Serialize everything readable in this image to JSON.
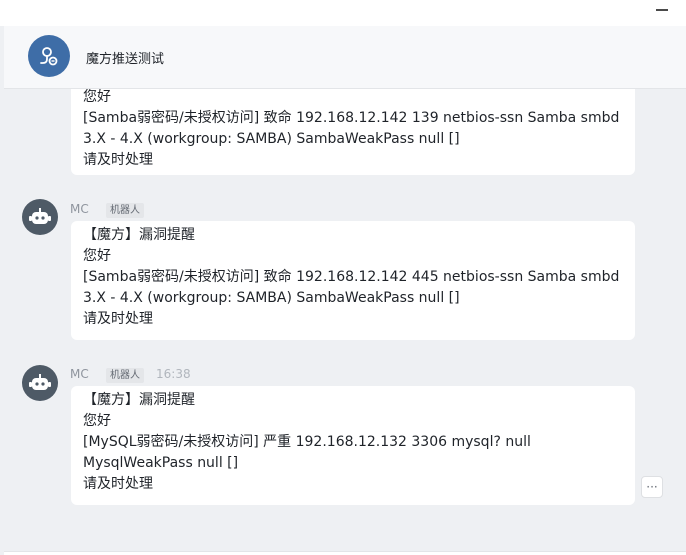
{
  "window": {
    "minimize_icon": "minimize-icon"
  },
  "header": {
    "group_name": "魔方推送测试",
    "avatar_icon": "group-link-icon",
    "avatar_color": "#3e6da7"
  },
  "messages": [
    {
      "lines": [
        "您好",
        "[Samba弱密码/未授权访问]  致命   192.168.12.142  139  netbios-ssn  Samba smbd",
        "3.X - 4.X (workgroup: SAMBA)  SambaWeakPass  null  []",
        "请及时处理"
      ]
    },
    {
      "sender": "MC",
      "tag": "机器人",
      "lines": [
        "【魔方】漏洞提醒",
        "您好",
        "[Samba弱密码/未授权访问]  致命   192.168.12.142  445  netbios-ssn  Samba smbd",
        "3.X - 4.X (workgroup: SAMBA)  SambaWeakPass  null  []",
        "请及时处理"
      ]
    },
    {
      "sender": "MC",
      "tag": "机器人",
      "time": "16:38",
      "lines": [
        "【魔方】漏洞提醒",
        "您好",
        "[MySQL弱密码/未授权访问]  严重   192.168.12.132  3306  mysql?  null",
        "MysqlWeakPass  null  []",
        "请及时处理"
      ]
    }
  ],
  "actions": {
    "more_label": "···"
  },
  "colors": {
    "bot_avatar": "#4e5a66",
    "background": "#eef0f3",
    "bubble": "#ffffff"
  }
}
